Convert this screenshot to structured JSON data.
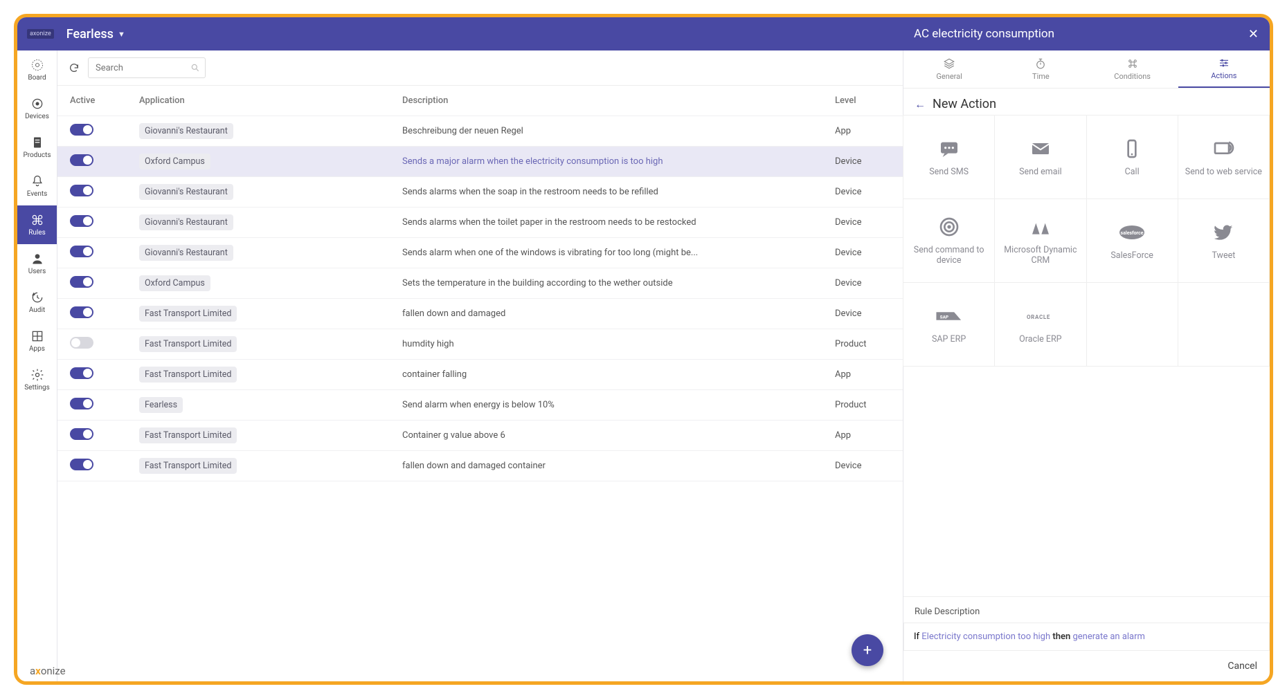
{
  "header": {
    "brand": "axonize",
    "project": "Fearless"
  },
  "nav": [
    {
      "id": "board",
      "label": "Board"
    },
    {
      "id": "devices",
      "label": "Devices"
    },
    {
      "id": "products",
      "label": "Products"
    },
    {
      "id": "events",
      "label": "Events"
    },
    {
      "id": "rules",
      "label": "Rules"
    },
    {
      "id": "users",
      "label": "Users"
    },
    {
      "id": "audit",
      "label": "Audit"
    },
    {
      "id": "apps",
      "label": "Apps"
    },
    {
      "id": "settings",
      "label": "Settings"
    }
  ],
  "search": {
    "placeholder": "Search"
  },
  "columns": {
    "active": "Active",
    "application": "Application",
    "description": "Description",
    "level": "Level"
  },
  "rows": [
    {
      "active": true,
      "app": "Giovanni's Restaurant",
      "desc": "Beschreibung der neuen Regel",
      "level": "App"
    },
    {
      "active": true,
      "app": "Oxford Campus",
      "desc": "Sends a major alarm when the electricity consumption is too high",
      "level": "Device",
      "selected": true
    },
    {
      "active": true,
      "app": "Giovanni's Restaurant",
      "desc": "Sends alarms when the soap in the restroom needs to be refilled",
      "level": "Device"
    },
    {
      "active": true,
      "app": "Giovanni's Restaurant",
      "desc": "Sends alarms when the toilet paper in the restroom needs to be restocked",
      "level": "Device"
    },
    {
      "active": true,
      "app": "Giovanni's Restaurant",
      "desc": "Sends alarm when one of the windows is vibrating for too long (might be...",
      "level": "Device"
    },
    {
      "active": true,
      "app": "Oxford Campus",
      "desc": "Sets the temperature in the building according to the wether outside",
      "level": "Device"
    },
    {
      "active": true,
      "app": "Fast Transport Limited",
      "desc": "fallen down and damaged",
      "level": "Device"
    },
    {
      "active": false,
      "app": "Fast Transport Limited",
      "desc": "humdity high",
      "level": "Product"
    },
    {
      "active": true,
      "app": "Fast Transport Limited",
      "desc": "container falling",
      "level": "App"
    },
    {
      "active": true,
      "app": "Fearless",
      "desc": "Send alarm when energy is below 10%",
      "level": "Product"
    },
    {
      "active": true,
      "app": "Fast Transport Limited",
      "desc": "Container g value above 6",
      "level": "App"
    },
    {
      "active": true,
      "app": "Fast Transport Limited",
      "desc": "fallen down and damaged container",
      "level": "Device"
    }
  ],
  "drawer": {
    "title": "AC electricity consumption",
    "tabs": [
      {
        "id": "general",
        "label": "General"
      },
      {
        "id": "time",
        "label": "Time"
      },
      {
        "id": "conditions",
        "label": "Conditions"
      },
      {
        "id": "actions",
        "label": "Actions"
      }
    ],
    "new_action": "New Action",
    "tiles": [
      {
        "id": "sms",
        "label": "Send SMS"
      },
      {
        "id": "email",
        "label": "Send email"
      },
      {
        "id": "call",
        "label": "Call"
      },
      {
        "id": "web",
        "label": "Send to web service"
      },
      {
        "id": "device",
        "label": "Send command to device"
      },
      {
        "id": "crm",
        "label": "Microsoft Dynamic CRM"
      },
      {
        "id": "salesforce",
        "label": "SalesForce"
      },
      {
        "id": "tweet",
        "label": "Tweet"
      },
      {
        "id": "sap",
        "label": "SAP ERP"
      },
      {
        "id": "oracle",
        "label": "Oracle ERP"
      }
    ],
    "rule_label": "Rule Description",
    "rule": {
      "if": "If",
      "cond": "Electricity consumption too high",
      "then": "then",
      "action": "generate an alarm"
    },
    "cancel": "Cancel"
  },
  "watermark": "axonize"
}
